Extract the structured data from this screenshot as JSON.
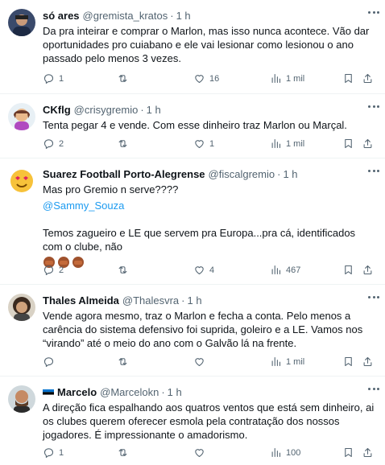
{
  "tweets": [
    {
      "name": "só ares",
      "handle": "@gremista_kratos",
      "dot": "·",
      "time": "1 h",
      "text": "Da pra inteirar e comprar o Marlon, mas isso nunca acontece. Vão dar oportunidades pro cuiabano e ele vai lesionar como lesionou o ano passado pelo menos 3 vezes.",
      "replies": "1",
      "retweets": "",
      "likes": "16",
      "views": "1 mil"
    },
    {
      "name": "CKflg",
      "handle": "@crisygremio",
      "dot": "·",
      "time": "1 h",
      "text": "Tenta pegar 4 e vende. Com esse dinheiro traz Marlon ou Marçal.",
      "replies": "2",
      "retweets": "",
      "likes": "1",
      "views": "1 mil"
    },
    {
      "name": "Suarez Football Porto-Alegrense",
      "handle": "@fiscalgremio",
      "dot": "·",
      "time": "1 h",
      "text": "Mas pro Gremio n serve????",
      "mention": "@Sammy_Souza",
      "text2": "Temos zagueiro e LE que servem pra Europa...pra cá, identificados com o clube, não",
      "emoji": "facepalm-emoji",
      "replies": "2",
      "retweets": "",
      "likes": "4",
      "views": "467"
    },
    {
      "name": "Thales Almeida",
      "handle": "@Thalesvra",
      "dot": "·",
      "time": "1 h",
      "text": "Vende agora mesmo, traz o Marlon e fecha a conta. Pelo menos a carência do sistema defensivo foi suprida, goleiro e a LE. Vamos nos “virando” até o meio do ano com o Galvão lá na frente.",
      "replies": "",
      "retweets": "",
      "likes": "",
      "views": "1 mil"
    },
    {
      "name": "Marcelo",
      "handle": "@Marcelokn",
      "dot": "·",
      "time": "1 h",
      "flag": "estonia-flag-icon",
      "text": "A direção fica espalhando aos quatros ventos que está sem dinheiro, ai os clubes querem oferecer esmola pela contratação dos nossos jogadores. É impressionante o amadorismo.",
      "replies": "1",
      "retweets": "",
      "likes": "",
      "views": "100"
    }
  ],
  "colors": {
    "text": "#0f1419",
    "muted": "#536471",
    "link": "#1d9bf0",
    "border": "#eff3f4"
  },
  "icons": [
    "reply-icon",
    "retweet-icon",
    "like-icon",
    "views-icon",
    "bookmark-icon",
    "share-icon",
    "more-icon"
  ]
}
